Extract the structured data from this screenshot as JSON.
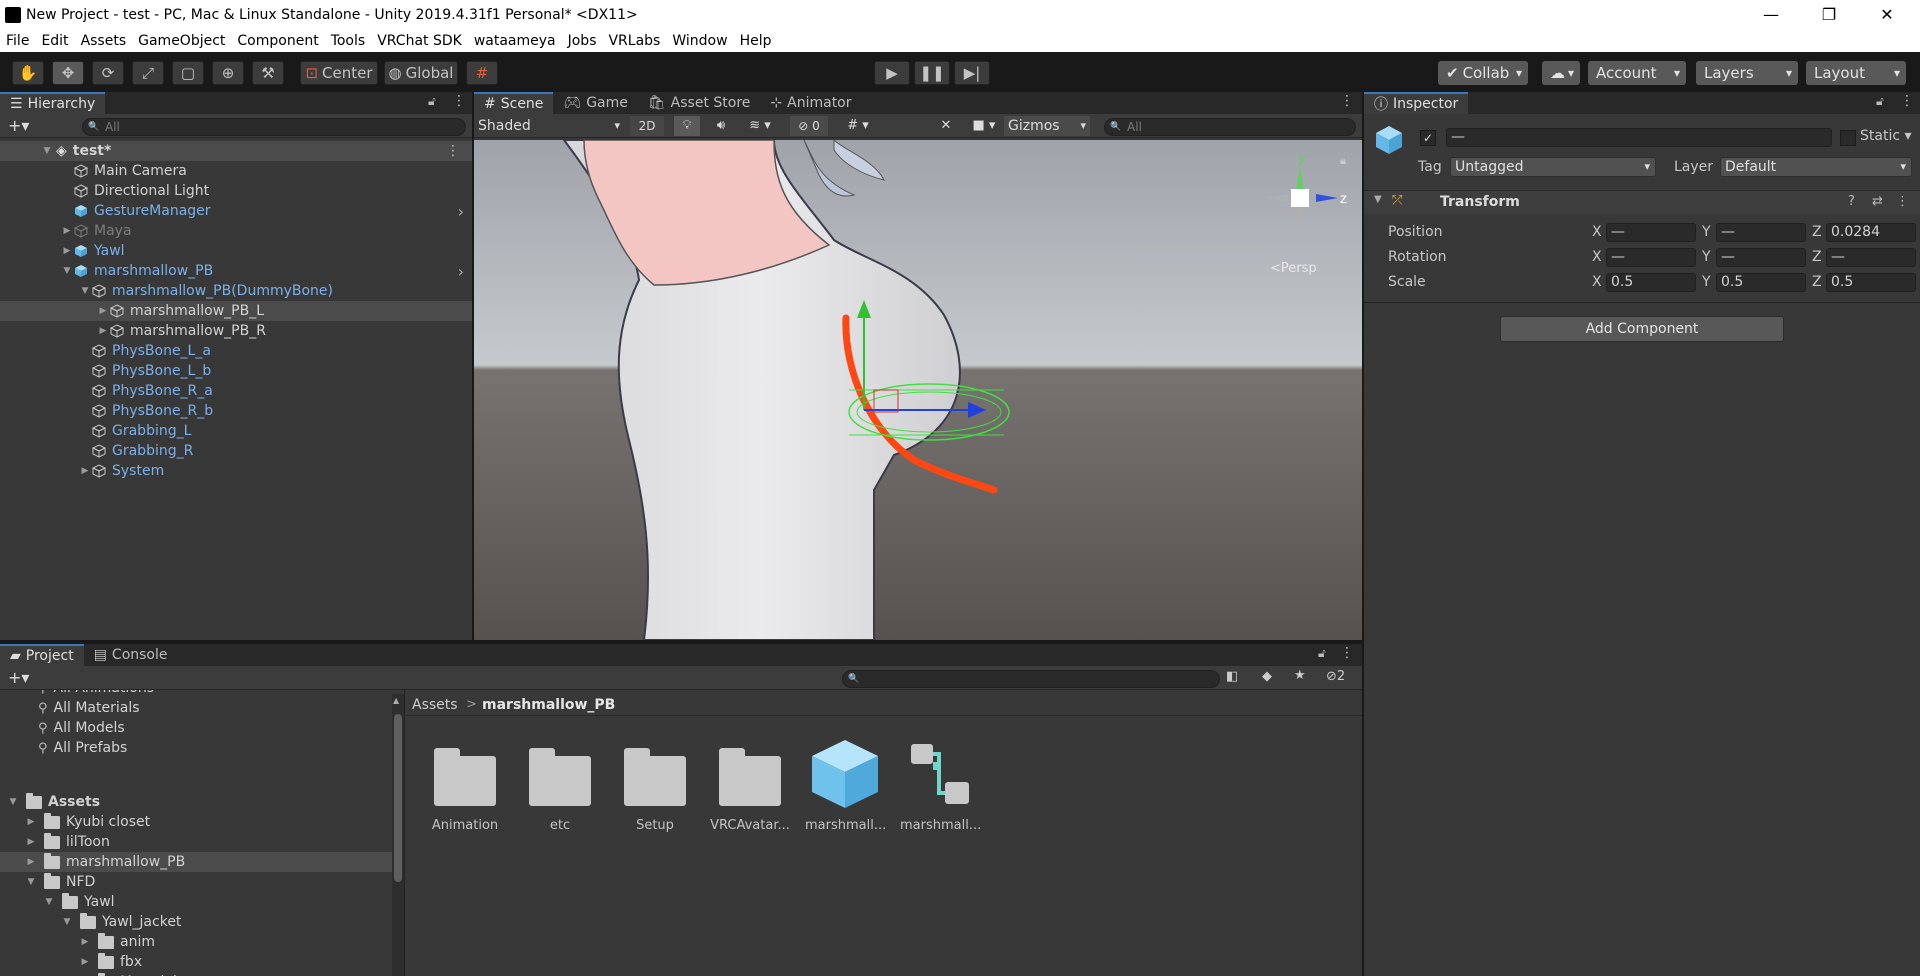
{
  "window": {
    "title": "New Project - test - PC, Mac & Linux Standalone - Unity 2019.4.31f1 Personal* <DX11>",
    "minimize": "—",
    "restore": "❐",
    "close": "✕"
  },
  "menu": [
    "File",
    "Edit",
    "Assets",
    "GameObject",
    "Component",
    "Tools",
    "VRChat SDK",
    "wataameya",
    "Jobs",
    "VRLabs",
    "Window",
    "Help"
  ],
  "toolbar": {
    "pivot_label": "Center",
    "space_label": "Global",
    "collab_label": "Collab",
    "account_label": "Account",
    "layers_label": "Layers",
    "layout_label": "Layout"
  },
  "hierarchy": {
    "tab_label": "Hierarchy",
    "search_placeholder": "All",
    "scene_name": "test*",
    "items": [
      {
        "label": "Main Camera",
        "style": "normal"
      },
      {
        "label": "Directional Light",
        "style": "normal"
      },
      {
        "label": "GestureManager",
        "style": "blue"
      },
      {
        "label": "Maya",
        "style": "grey"
      },
      {
        "label": "Yawl",
        "style": "blue"
      },
      {
        "label": "marshmallow_PB",
        "style": "blue"
      },
      {
        "label": "marshmallow_PB(DummyBone)",
        "style": "blue"
      },
      {
        "label": "marshmallow_PB_L",
        "style": "normal"
      },
      {
        "label": "marshmallow_PB_R",
        "style": "normal"
      },
      {
        "label": "PhysBone_L_a",
        "style": "blue"
      },
      {
        "label": "PhysBone_L_b",
        "style": "blue"
      },
      {
        "label": "PhysBone_R_a",
        "style": "blue"
      },
      {
        "label": "PhysBone_R_b",
        "style": "blue"
      },
      {
        "label": "Grabbing_L",
        "style": "blue"
      },
      {
        "label": "Grabbing_R",
        "style": "blue"
      },
      {
        "label": "System",
        "style": "blue"
      }
    ]
  },
  "scene": {
    "tabs": [
      "Scene",
      "Game",
      "Asset Store",
      "Animator"
    ],
    "shading_mode": "Shaded",
    "mode_2d": "2D",
    "hidden_count": "0",
    "gizmos_label": "Gizmos",
    "search_placeholder": "All",
    "gizmo_y": "y",
    "gizmo_z": "z",
    "persp_label": "<Persp"
  },
  "inspector": {
    "tab_label": "Inspector",
    "object_name": "—",
    "static_label": "Static",
    "tag_label": "Tag",
    "tag_value": "Untagged",
    "layer_label": "Layer",
    "layer_value": "Default",
    "component_title": "Transform",
    "rows": [
      {
        "label": "Position",
        "x": "—",
        "y": "—",
        "z": "0.0284"
      },
      {
        "label": "Rotation",
        "x": "—",
        "y": "—",
        "z": "—"
      },
      {
        "label": "Scale",
        "x": "0.5",
        "y": "0.5",
        "z": "0.5"
      }
    ],
    "axis_x": "X",
    "axis_y": "Y",
    "axis_z": "Z",
    "add_component_label": "Add Component"
  },
  "project": {
    "tabs": [
      "Project",
      "Console"
    ],
    "hidden_count": "2",
    "favorites": [
      "All Animations",
      "All Materials",
      "All Models",
      "All Prefabs"
    ],
    "tree": [
      {
        "label": "Assets",
        "depth": 0,
        "expanded": true
      },
      {
        "label": "Kyubi closet",
        "depth": 1,
        "expanded": false
      },
      {
        "label": "lilToon",
        "depth": 1,
        "expanded": false
      },
      {
        "label": "marshmallow_PB",
        "depth": 1,
        "expanded": false
      },
      {
        "label": "NFD",
        "depth": 1,
        "expanded": true
      },
      {
        "label": "Yawl",
        "depth": 2,
        "expanded": true
      },
      {
        "label": "Yawl_jacket",
        "depth": 3,
        "expanded": true
      },
      {
        "label": "anim",
        "depth": 4,
        "expanded": false
      },
      {
        "label": "fbx",
        "depth": 4,
        "expanded": false
      },
      {
        "label": "Materials",
        "depth": 4,
        "expanded": false
      }
    ],
    "breadcrumb_root": "Assets",
    "breadcrumb_sep": ">",
    "breadcrumb_current": "marshmallow_PB",
    "assets": [
      {
        "label": "Animation",
        "kind": "folder"
      },
      {
        "label": "etc",
        "kind": "folder"
      },
      {
        "label": "Setup",
        "kind": "folder"
      },
      {
        "label": "VRCAvatar...",
        "kind": "folder"
      },
      {
        "label": "marshmall...",
        "kind": "prefab"
      },
      {
        "label": "marshmall...",
        "kind": "controller"
      }
    ]
  },
  "colors": {
    "accent": "#3a79bb",
    "blue_text": "#7bb0ea",
    "panel": "#383838",
    "dark": "#191919"
  }
}
